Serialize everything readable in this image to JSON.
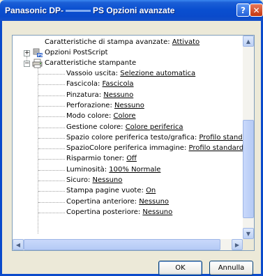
{
  "window": {
    "title_left": "Panasonic DP-",
    "title_right": "PS Opzioni avanzate",
    "help_glyph": "?",
    "close_glyph": "✕"
  },
  "tree": {
    "root": {
      "label": "Caratteristiche di stampa avanzate: ",
      "value": "Attivato"
    },
    "postscript": {
      "label": "Opzioni PostScript"
    },
    "printer": {
      "label": "Caratteristiche stampante"
    },
    "items": [
      {
        "label": "Vassoio uscita: ",
        "value": "Selezione automatica"
      },
      {
        "label": "Fascicola: ",
        "value": "Fascicola"
      },
      {
        "label": "Pinzatura: ",
        "value": "Nessuno"
      },
      {
        "label": "Perforazione: ",
        "value": "Nessuno"
      },
      {
        "label": "Modo colore: ",
        "value": "Colore"
      },
      {
        "label": "Gestione colore: ",
        "value": "Colore periferica"
      },
      {
        "label": "Spazio colore periferica testo/grafica: ",
        "value": "Profilo standard co"
      },
      {
        "label": "SpazioColore periferica immagine: ",
        "value": "Profilo standard con C"
      },
      {
        "label": "Risparmio toner: ",
        "value": "Off"
      },
      {
        "label": "Luminosità: ",
        "value": "100% Normale"
      },
      {
        "label": "Sicuro: ",
        "value": "Nessuno"
      },
      {
        "label": "Stampa pagine vuote: ",
        "value": "On"
      },
      {
        "label": "Copertina anteriore: ",
        "value": "Nessuno"
      },
      {
        "label": "Copertina posteriore: ",
        "value": "Nessuno"
      }
    ]
  },
  "scrollbar_glyphs": {
    "up": "▲",
    "down": "▼",
    "left": "◀",
    "right": "▶"
  },
  "buttons": {
    "ok": "OK",
    "cancel": "Annulla"
  }
}
